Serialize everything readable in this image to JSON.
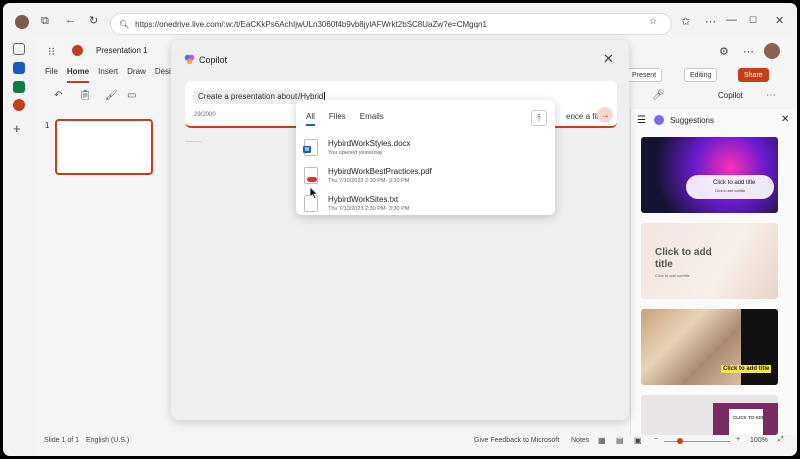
{
  "browser": {
    "url": "https://onedrive.live.com/:w:/t/EaCKkPs6AchIjwULn3060f4b9vb8jylAFWrkt2bSC8UaZw?e=CMgqn1"
  },
  "app": {
    "doc_title": "Presentation 1",
    "ribbon_tabs": [
      "File",
      "Home",
      "Insert",
      "Draw",
      "Design"
    ],
    "present_label": "Present",
    "editing_label": "Editing",
    "share_label": "Share",
    "copilot_label": "Copilot",
    "slide_number": "1",
    "status": {
      "slide": "Slide 1 of 1",
      "language": "English (U.S.)",
      "feedback": "Give Feedback to Microsoft",
      "notes": "Notes",
      "zoom": "100%"
    }
  },
  "suggestions": {
    "title": "Suggestions",
    "cards": [
      {
        "text": "Click to add title",
        "sub": "Click to add subtitle"
      },
      {
        "text": "Click to add title",
        "sub": "Click to add subtitle"
      },
      {
        "text": "Click to add title",
        "sub": ""
      },
      {
        "text": "CLICK TO ADD",
        "sub": ""
      }
    ]
  },
  "copilot": {
    "title": "Copilot",
    "prompt_chip": "Create a presentation about",
    "prompt_text": "/Hybrid",
    "char_count": "29/2000",
    "reference_label": "ence a file"
  },
  "file_picker": {
    "tabs": [
      "All",
      "Files",
      "Emails"
    ],
    "active_tab": "All",
    "files": [
      {
        "name": "HybirdWorkStyles.docx",
        "meta": "You opened yesterday",
        "type": "word"
      },
      {
        "name": "HybirdWorkBestPractices.pdf",
        "meta": "Thu 7/10/2023 2:30 PM- 3:30 PM",
        "type": "pdf"
      },
      {
        "name": "HybirdWorkSites.txt",
        "meta": "Thu 7/10/2023 2:30 PM- 3:30 PM",
        "type": "txt"
      }
    ]
  },
  "colors": {
    "accent": "#c43e1c",
    "link_blue": "#0f6cbd"
  }
}
